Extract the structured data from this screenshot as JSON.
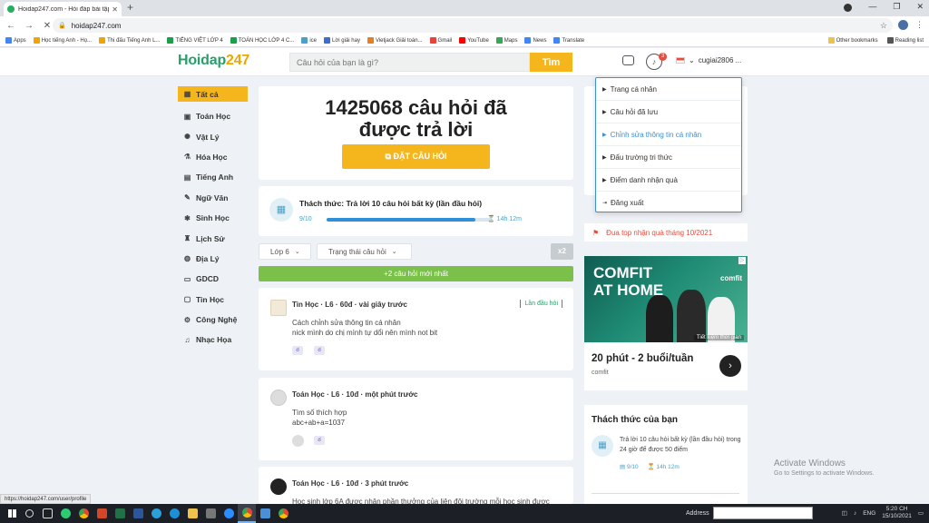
{
  "browser": {
    "tab_title": "Hoidap247.com - Hỏi đáp bài tập",
    "url": "hoidap247.com",
    "bookmarks": [
      "Apps",
      "Học tiếng Anh - Họ...",
      "Thi đấu Tiếng Anh L...",
      "TIẾNG VIỆT LỚP 4",
      "TOÁN HỌC LỚP 4 C...",
      "ice",
      "Lời giải hay",
      "Vietjack Giải toán...",
      "Gmail",
      "YouTube",
      "Maps",
      "News",
      "Translate"
    ],
    "bookmarks_right": [
      "Other bookmarks",
      "Reading list"
    ],
    "status_url": "https://hoidap247.com/user/profile"
  },
  "header": {
    "logo_main": "Hoidap",
    "logo_num": "247",
    "search_placeholder": "Câu hỏi của bạn là gì?",
    "search_button": "Tìm",
    "notification_count": "3",
    "username": "cugiai2806 ..."
  },
  "sidebar": {
    "items": [
      {
        "label": "Tất cả",
        "icon": "grid-icon"
      },
      {
        "label": "Toán Học",
        "icon": "math-icon"
      },
      {
        "label": "Vật Lý",
        "icon": "atom-icon"
      },
      {
        "label": "Hóa Học",
        "icon": "flask-icon"
      },
      {
        "label": "Tiếng Anh",
        "icon": "english-icon"
      },
      {
        "label": "Ngữ Văn",
        "icon": "pen-icon"
      },
      {
        "label": "Sinh Học",
        "icon": "dna-icon"
      },
      {
        "label": "Lịch Sử",
        "icon": "history-icon"
      },
      {
        "label": "Địa Lý",
        "icon": "globe-icon"
      },
      {
        "label": "GDCD",
        "icon": "civic-icon"
      },
      {
        "label": "Tin Học",
        "icon": "computer-icon"
      },
      {
        "label": "Công Nghệ",
        "icon": "tech-icon"
      },
      {
        "label": "Nhạc Họa",
        "icon": "music-icon"
      }
    ]
  },
  "hero": {
    "title_line1": "1425068 câu hỏi đã",
    "title_line2": "được trả lời",
    "ask_button": "ĐẶT CÂU HỎI"
  },
  "challenge": {
    "title": "Thách thức: Trả lời 10 câu hỏi bất kỳ (lần đầu hỏi)",
    "count": "9/10",
    "progress": 0.9,
    "time": "14h 12m"
  },
  "filters": {
    "grade": "Lớp 6",
    "status": "Trạng thái câu hỏi",
    "multiplier": "x2"
  },
  "new_questions": "+2 câu hỏi mới nhất",
  "questions": [
    {
      "subject": "Tin Học",
      "grade": "L6",
      "points": "60đ",
      "time": "vài giây trước",
      "text1": "Cách chỉnh sửa thông tin cá nhân",
      "text2": "nick mình do chị mình tự dổi nên mình not bit",
      "tag": "Lần đầu hỏi"
    },
    {
      "subject": "Toán Học",
      "grade": "L6",
      "points": "10đ",
      "time": "một phút trước",
      "text1": "Tìm số thích hợp",
      "text2": "abc+ab+a=1037",
      "tag": ""
    },
    {
      "subject": "Toán Học",
      "grade": "L6",
      "points": "10đ",
      "time": "3 phút trước",
      "text1": "Học sinh lớp 6A được nhận phần thưởng của liên đội trường mỗi học sinh được",
      "text2": "",
      "tag": ""
    }
  ],
  "right": {
    "race": "Đua top nhận quà tháng 10/2021",
    "ad_brand_line1": "COMFIT",
    "ad_brand_line2": "AT HOME",
    "ad_logo": "comfit",
    "ad_caption": "Tiết kiệm thời gian",
    "ad_title": "20 phút - 2 buổi/tuần",
    "ad_sub": "comfit",
    "challenge_title": "Thách thức của bạn",
    "challenge_text": "Trả lời 10 câu hỏi bất kỳ (lần đầu hỏi) trong 24 giờ để được 50 điểm",
    "challenge_count": "9/10",
    "challenge_time": "14h 12m"
  },
  "dropdown": {
    "items": [
      "Trang cá nhân",
      "Câu hỏi đã lưu",
      "Chỉnh sửa thông tin cá nhân",
      "Đấu trường tri thức",
      "Điểm danh nhận quà",
      "Đăng xuất"
    ]
  },
  "watermark": {
    "line1": "Activate Windows",
    "line2": "Go to Settings to activate Windows."
  },
  "taskbar": {
    "address_label": "Address",
    "lang": "ENG",
    "time": "5:20 CH",
    "date": "15/10/2021"
  }
}
